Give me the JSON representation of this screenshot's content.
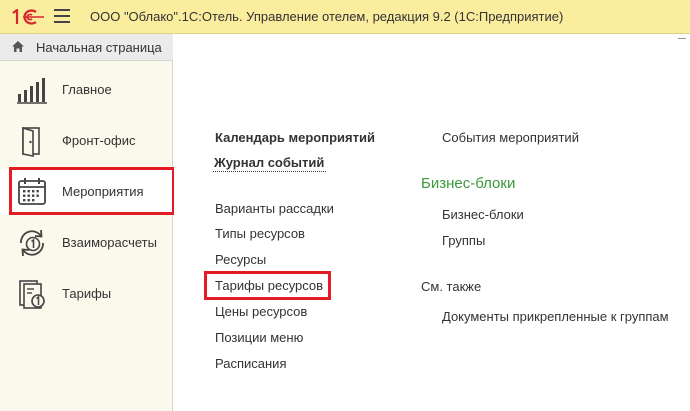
{
  "window": {
    "title": "ООО \"Облако\".1С:Отель. Управление отелем, редакция 9.2  (1С:Предприятие)"
  },
  "icons": {
    "logo": "1c-logo-icon",
    "menu": "hamburger-menu-icon",
    "home": "home-icon"
  },
  "colors": {
    "titlebar": "#fbed9e",
    "sidebar": "#fbf8ec",
    "highlight": "#e31b23",
    "section_title": "#3b9a3b"
  },
  "sidebar": {
    "home_label": "Начальная страница",
    "items": [
      {
        "label": "Главное",
        "icon": "bar-chart-icon"
      },
      {
        "label": "Фронт-офис",
        "icon": "door-icon"
      },
      {
        "label": "Мероприятия",
        "icon": "calendar-icon",
        "active": true
      },
      {
        "label": "Взаиморасчеты",
        "icon": "refresh-coin-icon"
      },
      {
        "label": "Тарифы",
        "icon": "tariff-doc-icon"
      }
    ]
  },
  "main": {
    "col1": {
      "bold_links": [
        "Календарь мероприятий",
        "Журнал событий"
      ],
      "links": [
        "Варианты рассадки",
        "Типы ресурсов",
        "Ресурсы",
        "Тарифы ресурсов",
        "Цены ресурсов",
        "Позиции меню",
        "Расписания"
      ]
    },
    "col2": {
      "top_link": "События мероприятий",
      "section_title": "Бизнес-блоки",
      "section_links": [
        "Бизнес-блоки",
        "Группы"
      ],
      "see_also_label": "См. также",
      "see_also_links": [
        "Документы прикрепленные к группам"
      ]
    }
  }
}
